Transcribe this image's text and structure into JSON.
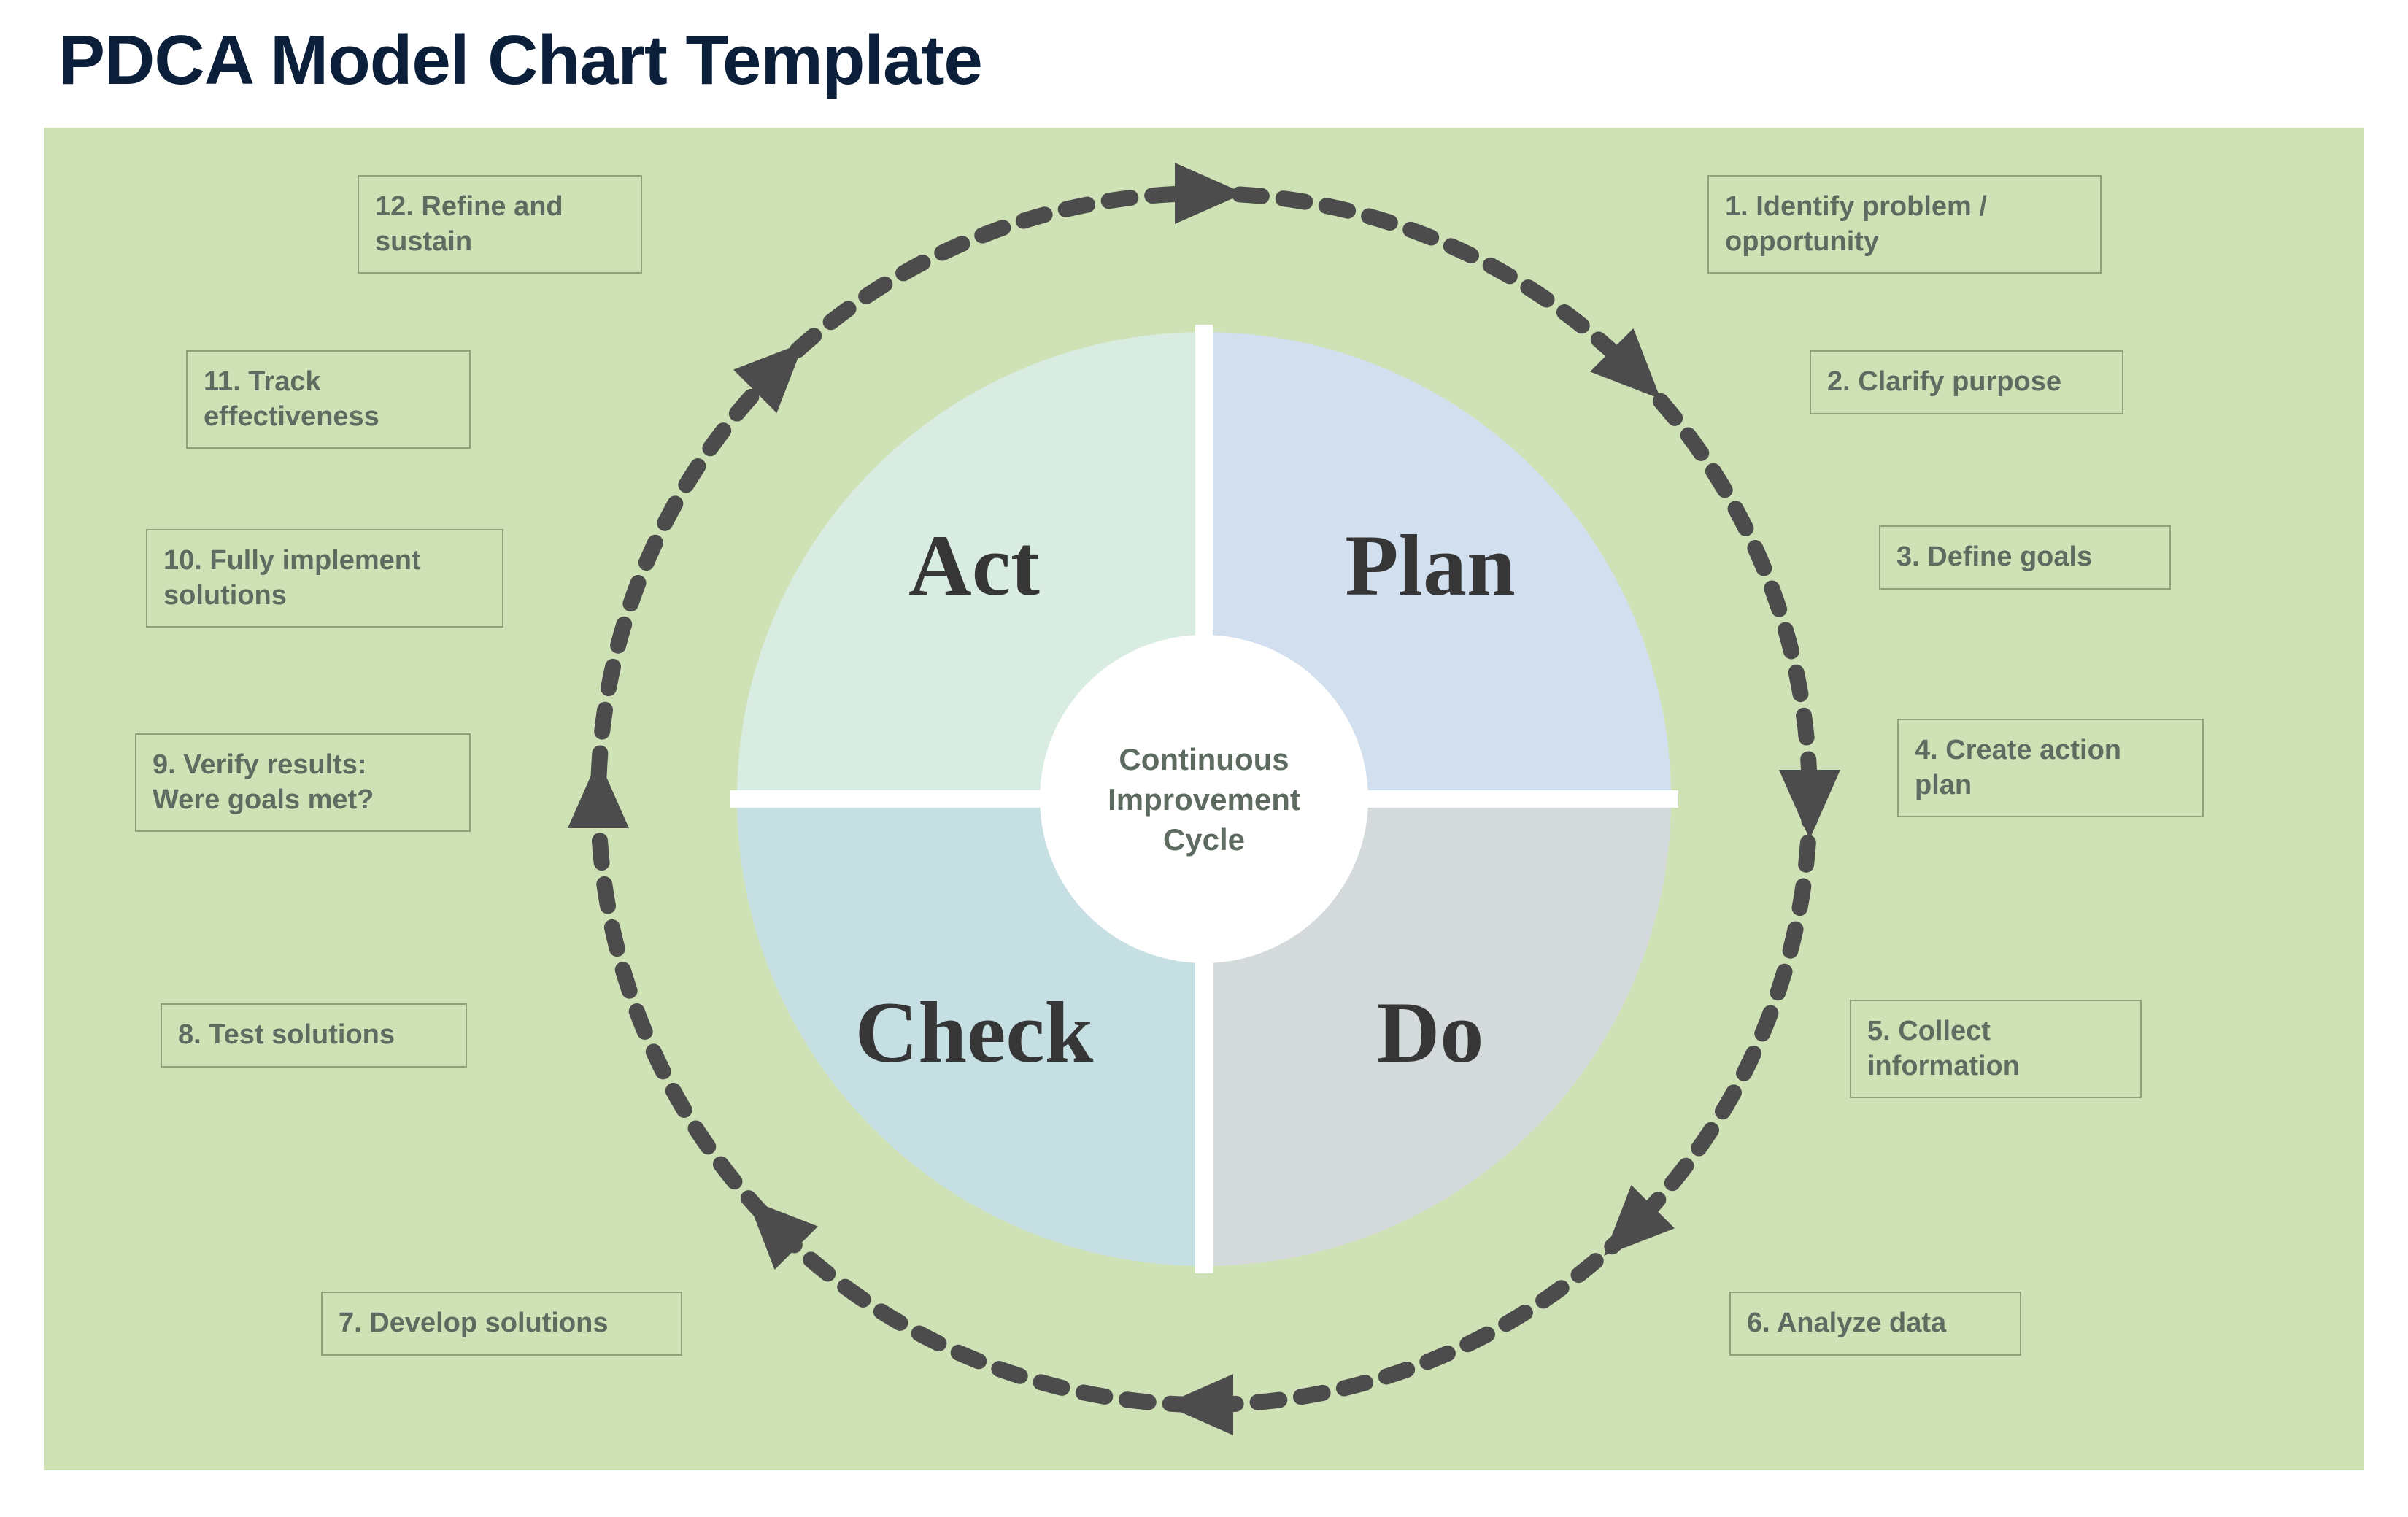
{
  "title": "PDCA Model Chart Template",
  "center_label": "Continuous\nImprovement\nCycle",
  "quadrants": {
    "plan": {
      "label": "Plan",
      "fill": "#d1dfee"
    },
    "do": {
      "label": "Do",
      "fill": "#d4dadb"
    },
    "check": {
      "label": "Check",
      "fill": "#c5dfe2"
    },
    "act": {
      "label": "Act",
      "fill": "#d9ece1"
    }
  },
  "steps": [
    {
      "n": 1,
      "text": "1. Identify problem /\nopportunity"
    },
    {
      "n": 2,
      "text": "2. Clarify purpose"
    },
    {
      "n": 3,
      "text": "3. Define goals"
    },
    {
      "n": 4,
      "text": "4. Create action\nplan"
    },
    {
      "n": 5,
      "text": "5. Collect\ninformation"
    },
    {
      "n": 6,
      "text": "6. Analyze data"
    },
    {
      "n": 7,
      "text": "7. Develop solutions"
    },
    {
      "n": 8,
      "text": "8. Test solutions"
    },
    {
      "n": 9,
      "text": "9. Verify results:\nWere goals met?"
    },
    {
      "n": 10,
      "text": "10. Fully implement\nsolutions"
    },
    {
      "n": 11,
      "text": "11. Track\neffectiveness"
    },
    {
      "n": 12,
      "text": "12. Refine and\nsustain"
    }
  ],
  "colors": {
    "panel_bg": "#cfe2b6",
    "step_border": "#8fa07a",
    "step_text": "#5d6b60",
    "title_text": "#0b1f3a",
    "arrow": "#4c4c4c",
    "hub_bg": "#ffffff",
    "divider": "#ffffff"
  },
  "chart_data": {
    "type": "process-cycle",
    "title": "PDCA Model Chart Template",
    "center": "Continuous Improvement Cycle",
    "phases": [
      {
        "name": "Plan",
        "quadrant": "top-right",
        "steps": [
          1,
          2,
          3,
          4
        ]
      },
      {
        "name": "Do",
        "quadrant": "bottom-right",
        "steps": [
          5,
          6
        ]
      },
      {
        "name": "Check",
        "quadrant": "bottom-left",
        "steps": [
          7,
          8
        ]
      },
      {
        "name": "Act",
        "quadrant": "top-left",
        "steps": [
          9,
          10,
          11,
          12
        ]
      }
    ],
    "step_labels": {
      "1": "Identify problem / opportunity",
      "2": "Clarify purpose",
      "3": "Define goals",
      "4": "Create action plan",
      "5": "Collect information",
      "6": "Analyze data",
      "7": "Develop solutions",
      "8": "Test solutions",
      "9": "Verify results: Were goals met?",
      "10": "Fully implement solutions",
      "11": "Track effectiveness",
      "12": "Refine and sustain"
    },
    "direction": "clockwise"
  }
}
